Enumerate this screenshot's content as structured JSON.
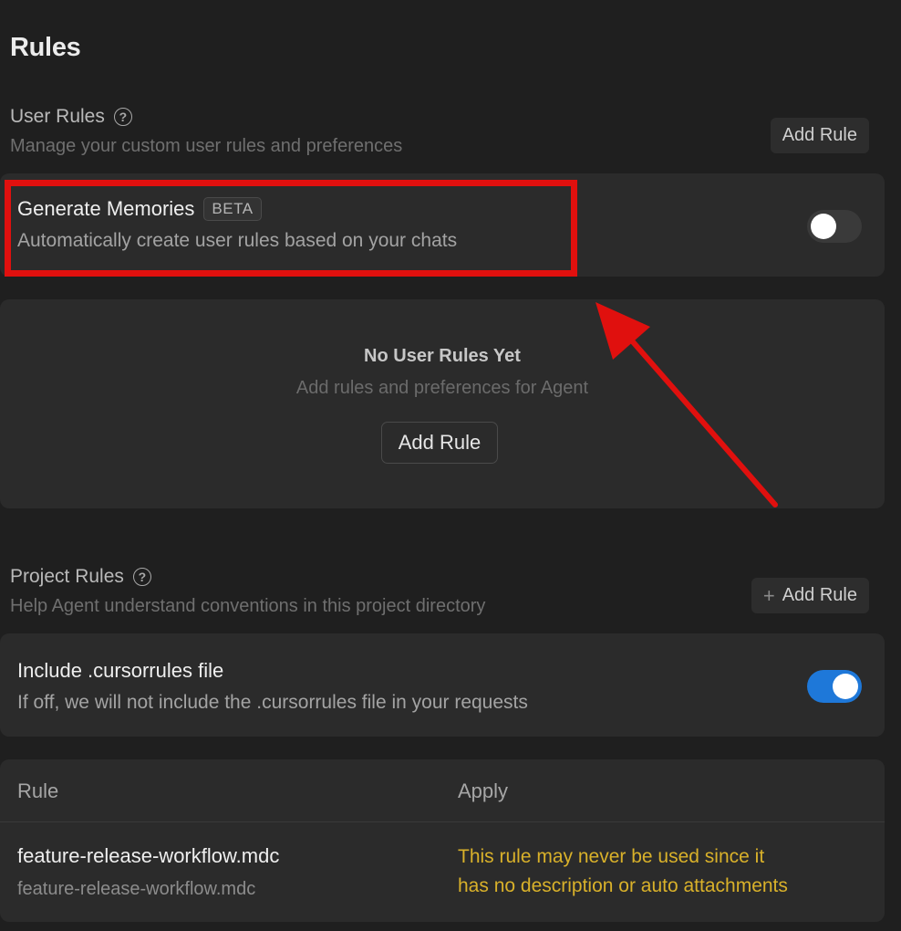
{
  "page": {
    "title": "Rules"
  },
  "user_rules": {
    "title": "User Rules",
    "description": "Manage your custom user rules and preferences",
    "add_button": "Add Rule",
    "generate_memories": {
      "title": "Generate Memories",
      "badge": "BETA",
      "description": "Automatically create user rules based on your chats",
      "enabled": false
    },
    "empty_state": {
      "title": "No User Rules Yet",
      "description": "Add rules and preferences for Agent",
      "button": "Add Rule"
    }
  },
  "project_rules": {
    "title": "Project Rules",
    "description": "Help Agent understand conventions in this project directory",
    "add_button": "Add Rule",
    "include_cursorrules": {
      "title": "Include .cursorrules file",
      "description": "If off, we will not include the .cursorrules file in your requests",
      "enabled": true
    },
    "table": {
      "headers": {
        "rule": "Rule",
        "apply": "Apply"
      },
      "rows": [
        {
          "name": "feature-release-workflow.mdc",
          "path": "feature-release-workflow.mdc",
          "apply_line1": "This rule may never be used since it",
          "apply_line2": "has no description or auto attachments"
        }
      ]
    }
  },
  "colors": {
    "background": "#1f1f1f",
    "card": "#2b2b2b",
    "toggle_on": "#1e78d9",
    "warning": "#d9b12a",
    "annotation": "#e0100e"
  },
  "icons": {
    "help": "question-circle-icon",
    "plus": "plus-icon"
  }
}
